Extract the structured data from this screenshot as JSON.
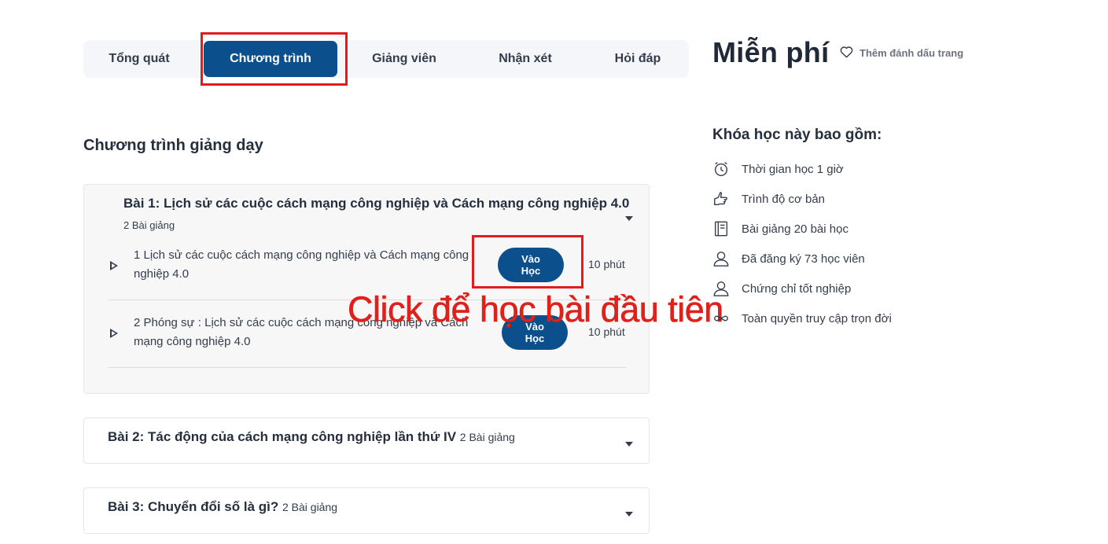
{
  "tabs": [
    {
      "label": "Tổng quát"
    },
    {
      "label": "Chương trình",
      "active": true
    },
    {
      "label": "Giảng viên"
    },
    {
      "label": "Nhận xét"
    },
    {
      "label": "Hỏi đáp"
    }
  ],
  "sidebar": {
    "price": "Miễn phí",
    "bookmark_label": "Thêm đánh dấu trang",
    "includes_title": "Khóa học này bao gồm:",
    "includes": [
      {
        "icon": "alarm-clock-icon",
        "label": "Thời gian học 1 giờ"
      },
      {
        "icon": "hand-pointing-icon",
        "label": "Trình độ cơ bản"
      },
      {
        "icon": "notebook-icon",
        "label": "Bài giảng 20 bài học"
      },
      {
        "icon": "user-icon",
        "label": "Đã đăng ký 73 học viên"
      },
      {
        "icon": "user-icon",
        "label": "Chứng chỉ tốt nghiệp"
      },
      {
        "icon": "infinity-icon",
        "label": "Toàn quyền truy cập trọn đời"
      }
    ]
  },
  "curriculum": {
    "title": "Chương trình giảng dạy",
    "sections": [
      {
        "title": "Bài 1: Lịch sử các cuộc cách mạng công nghiệp và Cách mạng công nghiệp 4.0",
        "count": "2 Bài giảng",
        "lectures": [
          {
            "title": "1 Lịch sử các cuộc cách mạng công nghiệp và Cách mạng công nghiệp 4.0",
            "button": "Vào Học",
            "duration": "10 phút"
          },
          {
            "title": "2 Phóng sự : Lịch sử các cuộc cách mạng công nghiệp và Cách mạng công nghiệp 4.0",
            "button": "Vào Học",
            "duration": "10 phút"
          }
        ]
      },
      {
        "title": "Bài 2: Tác động của cách mạng công nghiệp lần thứ IV",
        "count": "2 Bài giảng"
      },
      {
        "title": "Bài 3: Chuyển đổi số là gì?",
        "count": "2 Bài giảng"
      }
    ]
  },
  "annotation": {
    "text": "Click để học bài đầu tiên",
    "color": "#e0201b"
  },
  "colors": {
    "primary": "#0b4f8c",
    "highlight": "#e41b1b"
  }
}
